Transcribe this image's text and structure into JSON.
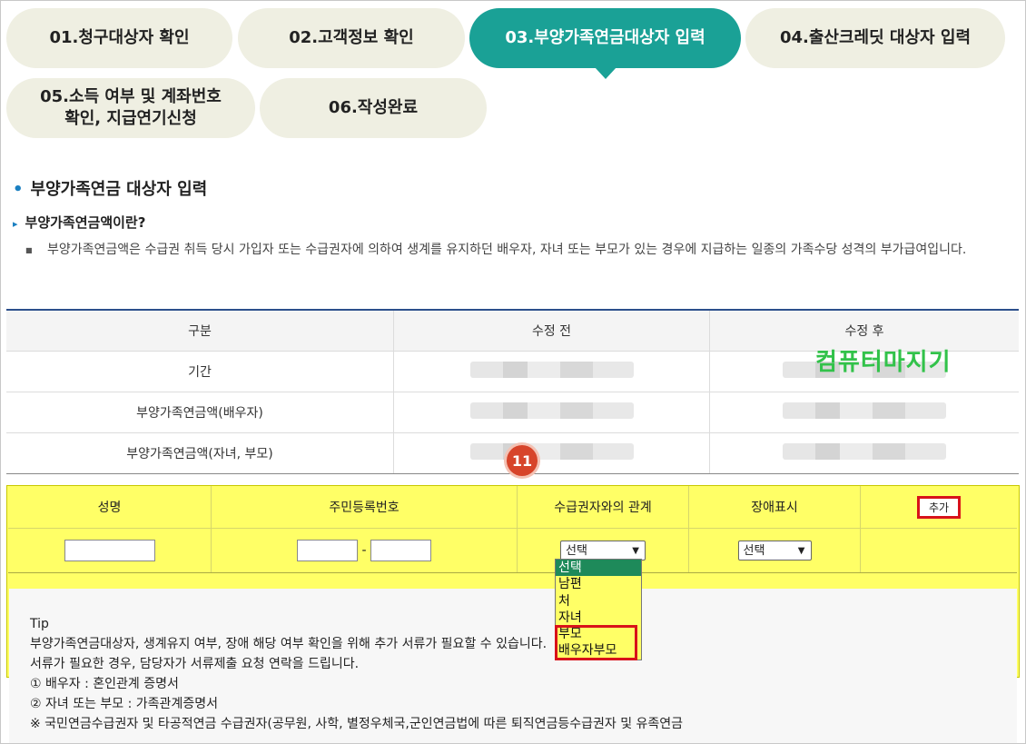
{
  "steps": [
    {
      "label": "01.청구대상자 확인"
    },
    {
      "label": "02.고객정보 확인"
    },
    {
      "label": "03.부양가족연금대상자 입력"
    },
    {
      "label": "04.출산크레딧 대상자 입력"
    },
    {
      "label": "05.소득 여부 및 계좌번호\n확인, 지급연기신청"
    },
    {
      "label": "06.작성완료"
    }
  ],
  "active_step": 3,
  "section": {
    "title": "부양가족연금 대상자 입력",
    "subtitle": "부양가족연금액이란?",
    "description": "부양가족연금액은 수급권 취득 당시 가입자 또는 수급권자에 의하여 생계를 유지하던 배우자, 자녀 또는 부모가 있는 경우에 지급하는 일종의 가족수당 성격의 부가급여입니다."
  },
  "compare_table": {
    "headers": [
      "구분",
      "수정 전",
      "수정 후"
    ],
    "rows": [
      {
        "label": "기간"
      },
      {
        "label": "부양가족연금액(배우자)"
      },
      {
        "label": "부양가족연금액(자녀, 부모)"
      }
    ]
  },
  "watermark": "컴퓨터마지기",
  "step_badge": "11",
  "input_table": {
    "headers": [
      "성명",
      "주민등록번호",
      "수급권자와의 관계",
      "장애표시"
    ],
    "add_button": "추가",
    "dash": "-",
    "relation_select": "선택",
    "disability_select": "선택"
  },
  "relation_options": [
    "선택",
    "남편",
    "처",
    "자녀",
    "부모",
    "배우자부모"
  ],
  "tip": {
    "title": "Tip",
    "lines": [
      "부양가족연금대상자, 생계유지 여부, 장애 해당 여부 확인을 위해 추가 서류가 필요할 수 있습니다.",
      "서류가 필요한 경우, 담당자가 서류제출 요청 연락을 드립니다.",
      "① 배우자 : 혼인관계 증명서",
      "② 자녀 또는 부모 : 가족관계증명서",
      "※ 국민연금수급권자 및 타공적연금 수급권자(공무원, 사학, 별정우체국,군인연금법에 따른 퇴직연금등수급권자 및 유족연금"
    ]
  },
  "colors": {
    "active": "#1aa196",
    "inactive": "#efefe2",
    "highlight": "#ffff66",
    "accent": "#d8121a"
  }
}
